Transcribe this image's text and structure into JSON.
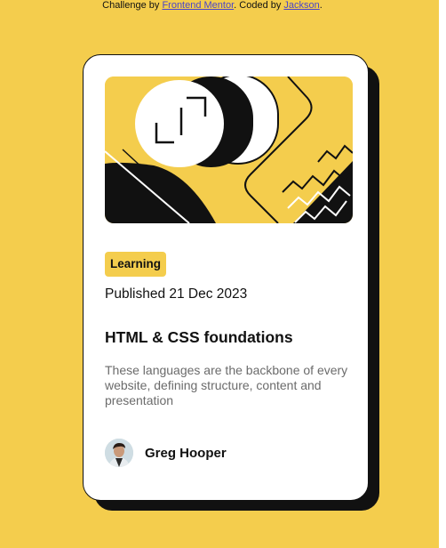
{
  "attribution": {
    "prefix": "Challenge by ",
    "challenge_link": "Frontend Mentor",
    "middle": ". Coded by ",
    "author_link": "Jackson",
    "suffix": "."
  },
  "card": {
    "tag": "Learning",
    "published": "Published 21 Dec 2023",
    "title": "HTML & CSS foundations",
    "description": "These languages are the backbone of every website, defining structure, content and presentation",
    "author_name": "Greg Hooper"
  },
  "colors": {
    "background": "#f4cd4d",
    "card": "#ffffff",
    "text": "#111111",
    "muted": "#6b6b6b",
    "link": "#4a45c9"
  }
}
